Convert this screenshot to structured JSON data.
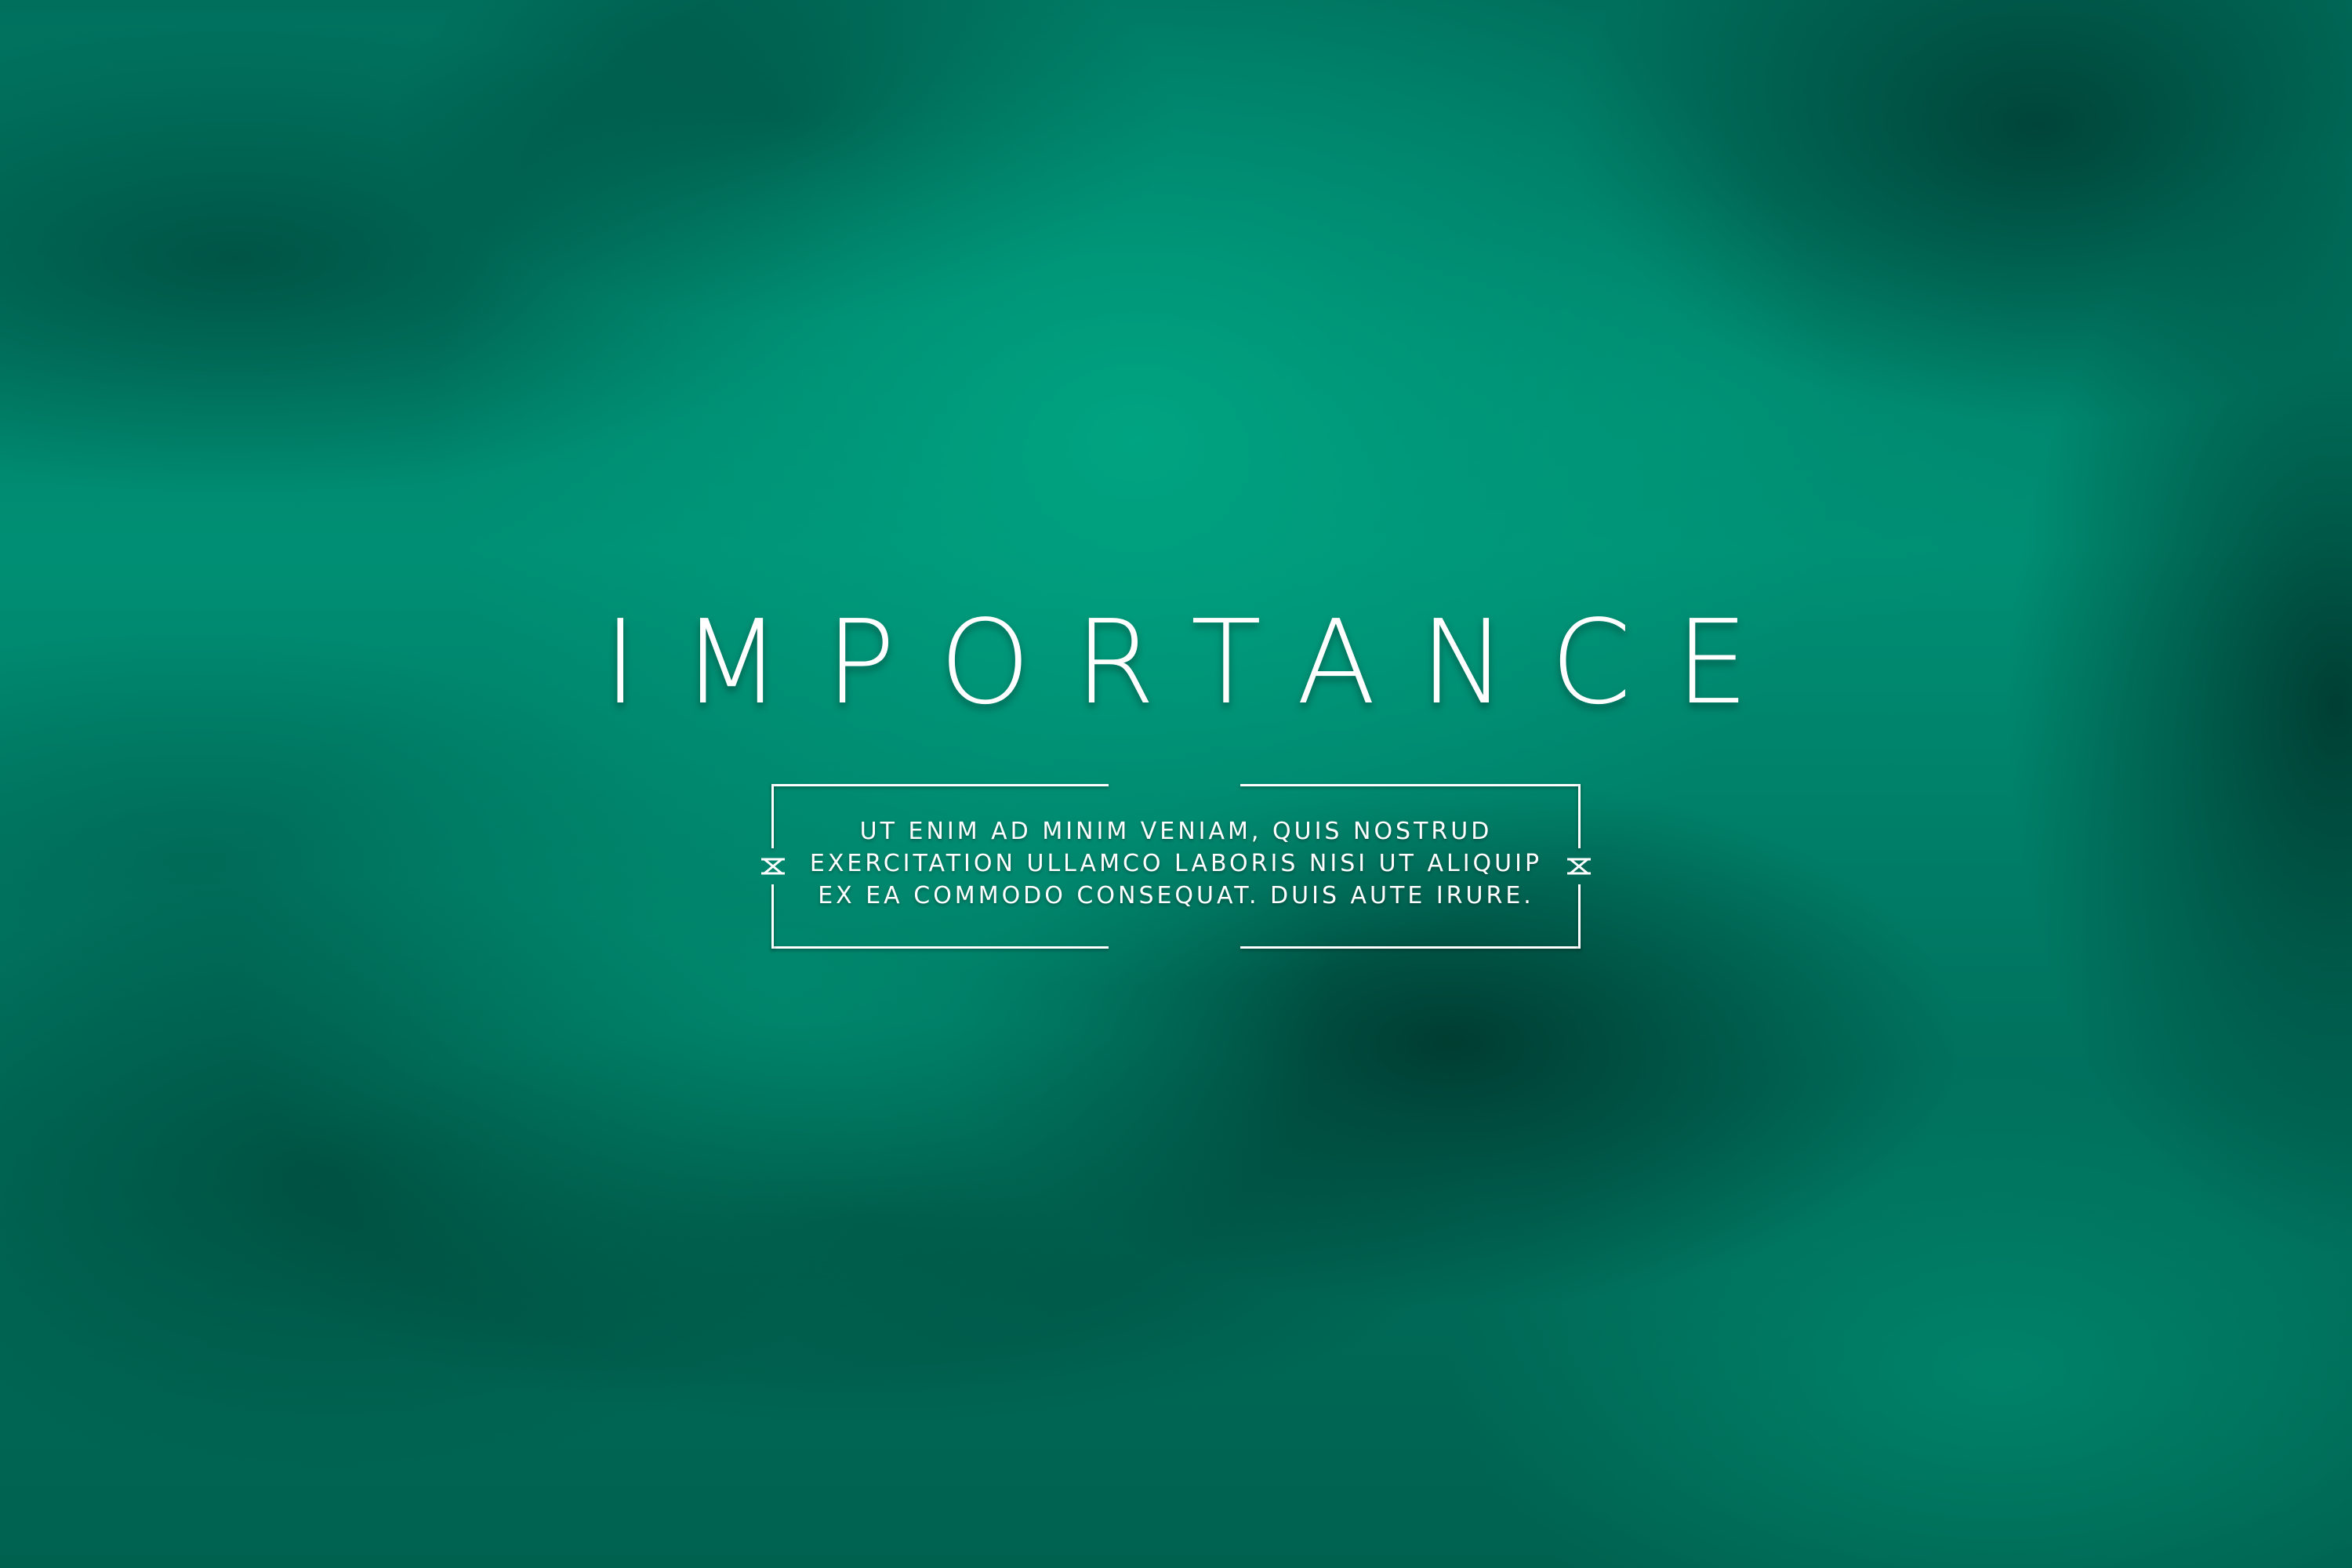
{
  "title": "IMPORTANCE",
  "body_lines": [
    "UT ENIM AD MINIM VENIAM, QUIS NOSTRUD",
    "EXERCITATION ULLAMCO LABORIS NISI UT ALIQUIP",
    "EX EA COMMODO CONSEQUAT. DUIS AUTE IRURE."
  ],
  "colors": {
    "background": "#00705d",
    "highlight": "#00a582",
    "text": "#ffffff"
  },
  "icons": {
    "left_ornament": "hourglass-ornament-icon",
    "right_ornament": "hourglass-ornament-icon"
  }
}
